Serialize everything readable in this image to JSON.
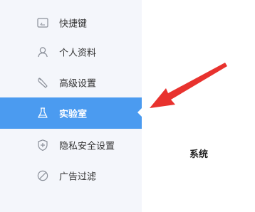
{
  "sidebar": {
    "items": [
      {
        "label": "快捷键",
        "icon": "keyboard-icon",
        "active": false
      },
      {
        "label": "个人资料",
        "icon": "user-icon",
        "active": false
      },
      {
        "label": "高级设置",
        "icon": "wrench-icon",
        "active": false
      },
      {
        "label": "实验室",
        "icon": "flask-icon",
        "active": true
      },
      {
        "label": "隐私安全设置",
        "icon": "shield-plus-icon",
        "active": false
      },
      {
        "label": "广告过滤",
        "icon": "block-icon",
        "active": false
      }
    ]
  },
  "content": {
    "section_title": "系统"
  },
  "annotation": {
    "arrow_color": "#e8322e"
  },
  "colors": {
    "sidebar_bg": "#f4f6fb",
    "active_bg": "#4b9bf0",
    "icon_gray": "#8a8f99"
  }
}
